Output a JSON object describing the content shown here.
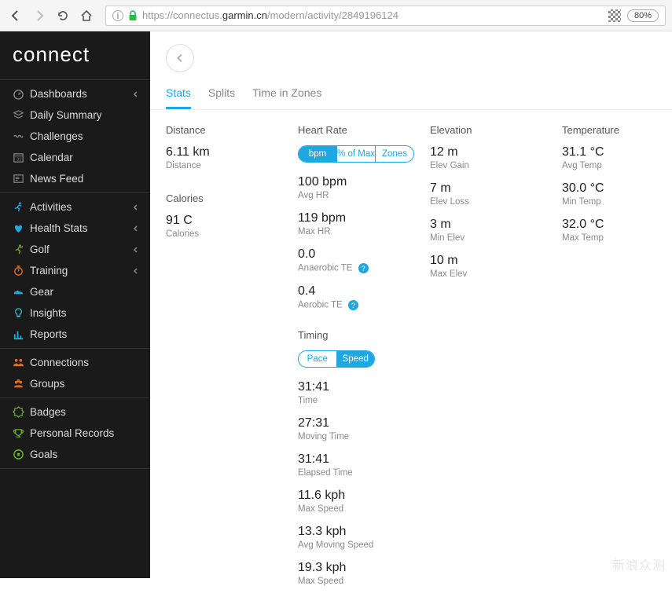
{
  "browser": {
    "url_prefix": "https://connectus.",
    "url_bold": "garmin.cn",
    "url_suffix": "/modern/activity/2849196124",
    "zoom": "80%"
  },
  "logo": "connect",
  "nav": {
    "block1": [
      {
        "icon": "speedometer",
        "label": "Dashboards",
        "chev": true
      },
      {
        "icon": "layers",
        "label": "Daily Summary",
        "chev": false
      },
      {
        "icon": "wave",
        "label": "Challenges",
        "chev": false
      },
      {
        "icon": "calendar",
        "label": "Calendar",
        "chev": false
      },
      {
        "icon": "news",
        "label": "News Feed",
        "chev": false
      }
    ],
    "block2": [
      {
        "icon": "runner",
        "label": "Activities",
        "chev": true,
        "color": "#1fa7e0"
      },
      {
        "icon": "heart",
        "label": "Health Stats",
        "chev": true,
        "color": "#1fa7e0"
      },
      {
        "icon": "golf",
        "label": "Golf",
        "chev": true,
        "color": "#78a63a"
      },
      {
        "icon": "stopwatch",
        "label": "Training",
        "chev": true,
        "color": "#e06a1f"
      },
      {
        "icon": "shoe",
        "label": "Gear",
        "chev": false,
        "color": "#1fa7e0"
      },
      {
        "icon": "bulb",
        "label": "Insights",
        "chev": false,
        "color": "#1fc7d0"
      },
      {
        "icon": "chart",
        "label": "Reports",
        "chev": false,
        "color": "#1fa7e0"
      }
    ],
    "block3": [
      {
        "icon": "people",
        "label": "Connections",
        "chev": false,
        "color": "#e06a1f"
      },
      {
        "icon": "group",
        "label": "Groups",
        "chev": false,
        "color": "#e06a1f"
      }
    ],
    "block4": [
      {
        "icon": "badge",
        "label": "Badges",
        "chev": false,
        "color": "#6ab82f"
      },
      {
        "icon": "trophy",
        "label": "Personal Records",
        "chev": false,
        "color": "#6ab82f"
      },
      {
        "icon": "target",
        "label": "Goals",
        "chev": false,
        "color": "#6ab82f"
      }
    ]
  },
  "tabs": [
    "Stats",
    "Splits",
    "Time in Zones"
  ],
  "stats": {
    "distance": {
      "label": "Distance",
      "value": "6.11 km",
      "sub": "Distance"
    },
    "calories": {
      "label": "Calories",
      "value": "91 C",
      "sub": "Calories"
    },
    "heartRate": {
      "label": "Heart Rate",
      "pills": [
        "bpm",
        "% of Max",
        "Zones"
      ],
      "metrics": [
        {
          "val": "100 bpm",
          "sub": "Avg HR"
        },
        {
          "val": "119 bpm",
          "sub": "Max HR"
        },
        {
          "val": "0.0",
          "sub": "Anaerobic TE",
          "info": true
        },
        {
          "val": "0.4",
          "sub": "Aerobic TE",
          "info": true
        }
      ]
    },
    "elevation": {
      "label": "Elevation",
      "metrics": [
        {
          "val": "12 m",
          "sub": "Elev Gain"
        },
        {
          "val": "7 m",
          "sub": "Elev Loss"
        },
        {
          "val": "3 m",
          "sub": "Min Elev"
        },
        {
          "val": "10 m",
          "sub": "Max Elev"
        }
      ]
    },
    "temperature": {
      "label": "Temperature",
      "metrics": [
        {
          "val": "31.1 °C",
          "sub": "Avg Temp"
        },
        {
          "val": "30.0 °C",
          "sub": "Min Temp"
        },
        {
          "val": "32.0 °C",
          "sub": "Max Temp"
        }
      ]
    },
    "timing": {
      "label": "Timing",
      "pills": [
        "Pace",
        "Speed"
      ],
      "metrics": [
        {
          "val": "31:41",
          "sub": "Time"
        },
        {
          "val": "27:31",
          "sub": "Moving Time"
        },
        {
          "val": "31:41",
          "sub": "Elapsed Time"
        },
        {
          "val": "11.6 kph",
          "sub": "Max Speed"
        },
        {
          "val": "13.3 kph",
          "sub": "Avg Moving Speed"
        },
        {
          "val": "19.3 kph",
          "sub": "Max Speed"
        }
      ]
    }
  },
  "watermark": "新浪众测"
}
